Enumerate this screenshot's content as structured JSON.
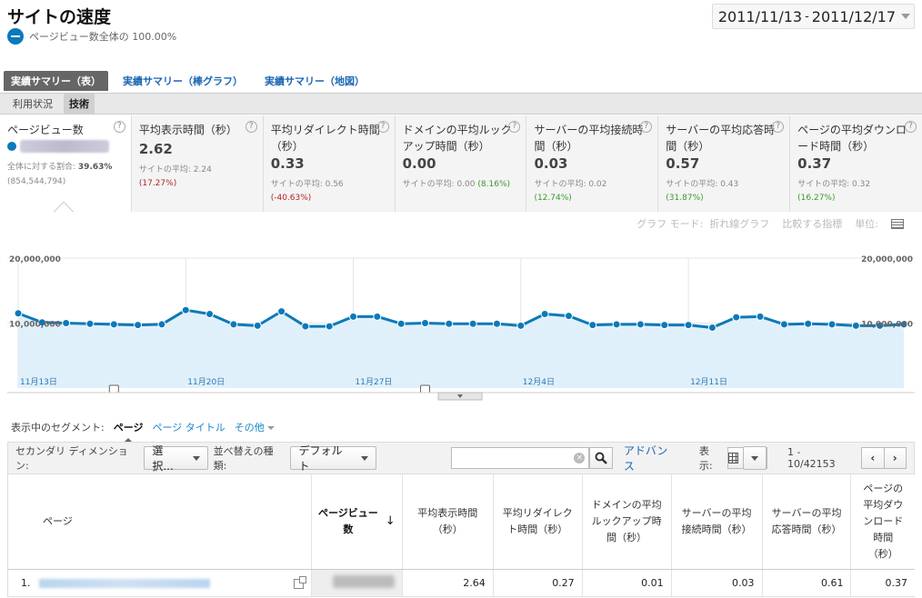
{
  "page": {
    "title": "サイトの速度",
    "subtitle": "ページビュー数全体の 100.00%"
  },
  "date_range": {
    "start": "2011/11/13",
    "sep": "-",
    "end": "2011/12/17"
  },
  "tabs": [
    {
      "label": "実績サマリー（表）",
      "active": true
    },
    {
      "label": "実績サマリー（棒グラフ）",
      "active": false
    },
    {
      "label": "実績サマリー（地図）",
      "active": false
    }
  ],
  "subtabs": [
    {
      "label": "利用状況",
      "active": false
    },
    {
      "label": "技術",
      "active": true
    }
  ],
  "metrics": [
    {
      "name": "ページビュー数",
      "share_label": "全体に対する割合:",
      "share_value": "39.63%",
      "share_total": "(854,544,794)"
    },
    {
      "name": "平均表示時間（秒）",
      "value": "2.62",
      "avg": "サイトの平均: 2.24",
      "pct": "(17.27%)",
      "pct_color": "red"
    },
    {
      "name": "平均リダイレクト時間\n（秒）",
      "value": "0.33",
      "avg": "サイトの平均: 0.56",
      "pct": "(-40.63%)",
      "pct_color": "red"
    },
    {
      "name": "ドメインの平均ルック\nアップ時間（秒）",
      "value": "0.00",
      "avg": "サイトの平均: 0.00",
      "pct": "(8.16%)",
      "pct_color": "green"
    },
    {
      "name": "サーバーの平均接続時\n間（秒）",
      "value": "0.03",
      "avg": "サイトの平均: 0.02",
      "pct": "(12.74%)",
      "pct_color": "green"
    },
    {
      "name": "サーバーの平均応答時\n間（秒）",
      "value": "0.57",
      "avg": "サイトの平均: 0.43",
      "pct": "(31.87%)",
      "pct_color": "green"
    },
    {
      "name": "ページの平均ダウンロ\nード時間（秒）",
      "value": "0.37",
      "avg": "サイトの平均: 0.32",
      "pct": "(16.27%)",
      "pct_color": "green"
    }
  ],
  "graph_bar": {
    "mode_label": "グラフ モード:",
    "mode_value": "折れ線グラフ",
    "compare": "比較する指標",
    "unit": "単位:"
  },
  "chart_data": {
    "type": "area",
    "series": [
      {
        "values": [
          11.5,
          10.1,
          10.0,
          9.9,
          9.8,
          9.7,
          9.8,
          12.0,
          11.4,
          9.8,
          9.6,
          11.8,
          9.5,
          9.5,
          11.0,
          11.0,
          9.9,
          10.0,
          9.9,
          9.9,
          9.9,
          9.6,
          11.4,
          11.1,
          9.7,
          9.8,
          9.8,
          9.7,
          9.7,
          9.3,
          10.9,
          11.0,
          9.8,
          9.9,
          9.8,
          9.6,
          9.6,
          9.8
        ]
      }
    ],
    "x_ticks": [
      "11月13日",
      "11月20日",
      "11月27日",
      "12月4日",
      "12月11日"
    ],
    "y_ticks_left": [
      "20,000,000",
      "10,000,000"
    ],
    "y_ticks_right": [
      "20,000,000",
      "10,000,000"
    ],
    "ylim": [
      0,
      20
    ],
    "color": "#0c79b9",
    "fill": "#e0f0fa"
  },
  "segments": {
    "label": "表示中のセグメント:",
    "items": [
      {
        "label": "ページ",
        "active": true
      },
      {
        "label": "ページ タイトル",
        "active": false
      },
      {
        "label": "その他",
        "active": false
      }
    ]
  },
  "controls": {
    "secondary_label": "セカンダリ ディメンション:",
    "secondary_value": "選択...",
    "sort_label": "並べ替えの種類:",
    "sort_value": "デフォルト",
    "search_placeholder": "",
    "advanced": "アドバンス",
    "show_label": "表示:",
    "range": "1 - 10/42153"
  },
  "table": {
    "headers": [
      "ページ",
      "ページビュー\n数",
      "平均表示時間\n（秒）",
      "平均リダイレク\nト時間（秒）",
      "ドメインの平均\nルックアップ時\n間（秒）",
      "サーバーの平均\n接続時間（秒）",
      "サーバーの平均\n応答時間（秒）",
      "ページの\n平均ダウ\nンロード\n時間\n（秒）"
    ],
    "rows": [
      {
        "index": "1.",
        "values": [
          "2.64",
          "0.27",
          "0.01",
          "0.03",
          "0.61",
          "0.37"
        ]
      }
    ]
  }
}
